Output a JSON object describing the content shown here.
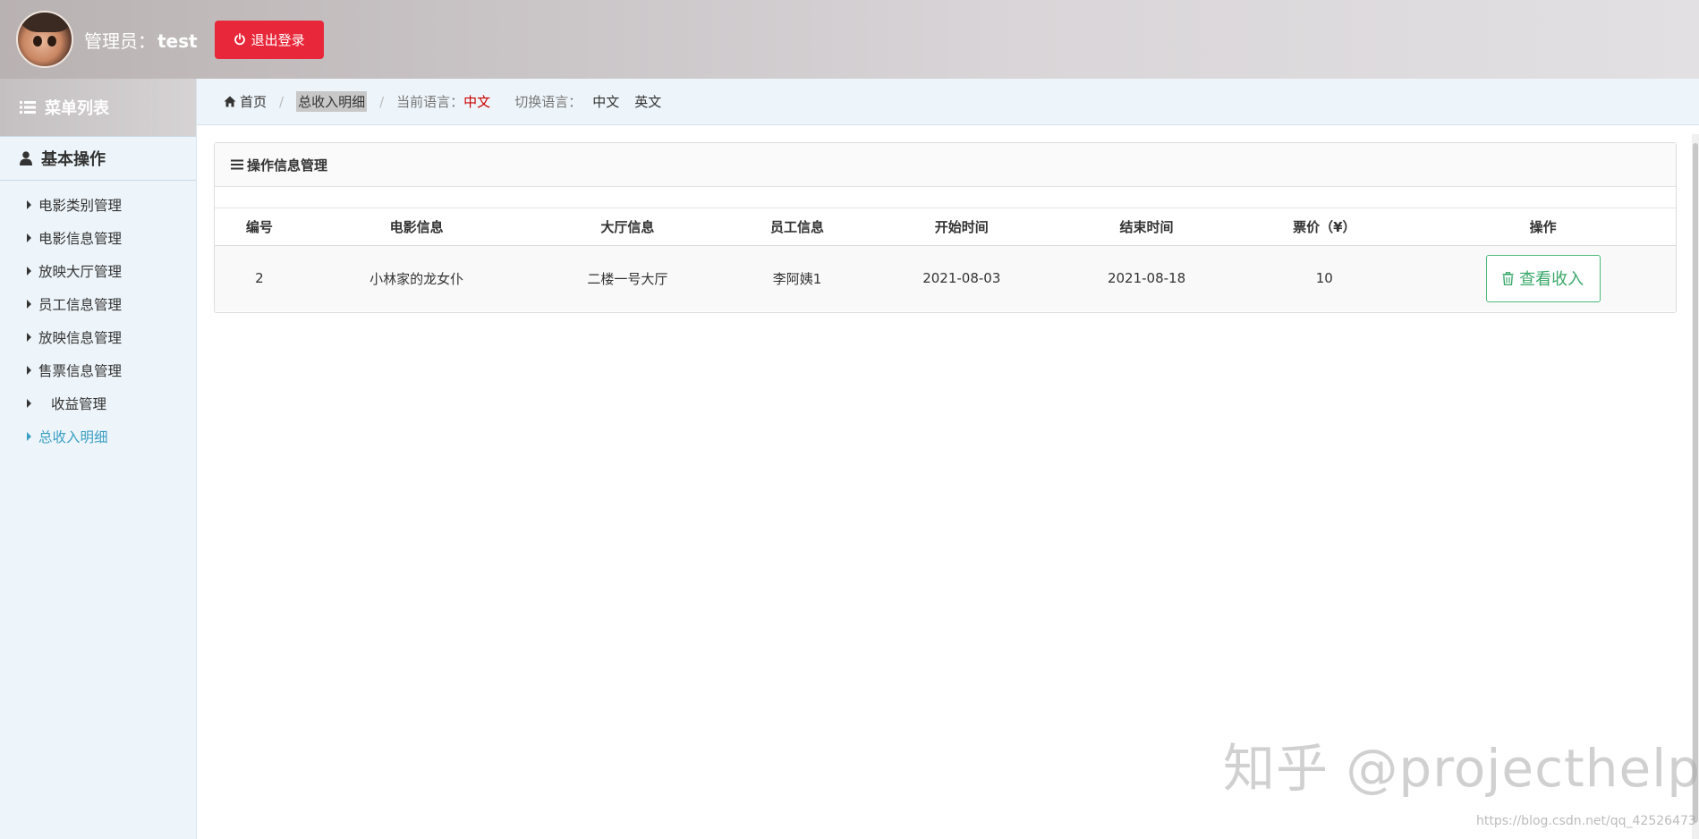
{
  "header": {
    "admin_label": "管理员：",
    "admin_name": "test",
    "logout_label": "退出登录",
    "logout_color": "#e8283a"
  },
  "sidebar": {
    "menu_title": "菜单列表",
    "section_title": "基本操作",
    "items": [
      {
        "label": "电影类别管理"
      },
      {
        "label": "电影信息管理"
      },
      {
        "label": "放映大厅管理"
      },
      {
        "label": "员工信息管理"
      },
      {
        "label": "放映信息管理"
      },
      {
        "label": "售票信息管理"
      },
      {
        "label": "收益管理"
      },
      {
        "label": "总收入明细"
      }
    ],
    "active_item": "总收入明细",
    "active_color": "#3a9ec4"
  },
  "breadcrumb": {
    "home": "首页",
    "current": "总收入明细",
    "current_lang_label": "当前语言：",
    "current_lang_value": "中文",
    "switch_lang_label": "切换语言：",
    "lang_zh": "中文",
    "lang_en": "英文"
  },
  "panel": {
    "title": "操作信息管理",
    "columns": [
      "编号",
      "电影信息",
      "大厅信息",
      "员工信息",
      "开始时间",
      "结束时间",
      "票价（¥）",
      "操作"
    ],
    "rows": [
      {
        "id": "2",
        "movie": "小林家的龙女仆",
        "hall": "二楼一号大厅",
        "staff": "李阿姨1",
        "start": "2021-08-03",
        "end": "2021-08-18",
        "price": "10",
        "action_label": "查看收入"
      }
    ]
  },
  "watermark": {
    "text": "知乎 @projecthelp",
    "url": "https://blog.csdn.net/qq_42526473"
  },
  "icons": {
    "power": "power-icon",
    "list": "list-icon",
    "user": "user-icon",
    "home": "home-icon",
    "bars": "bars-icon",
    "trash": "trash-icon"
  }
}
